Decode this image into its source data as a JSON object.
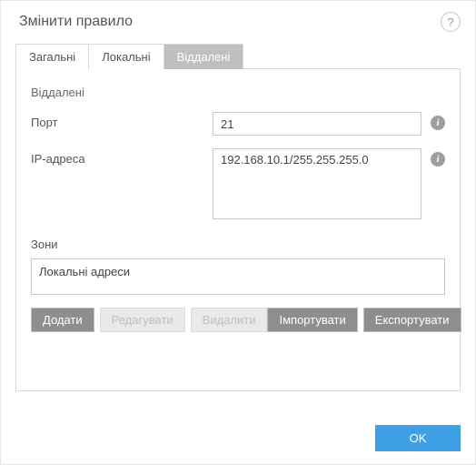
{
  "header": {
    "title": "Змінити правило",
    "help_tooltip": "?"
  },
  "tabs": {
    "general": "Загальні",
    "local": "Локальні",
    "remote": "Віддалені"
  },
  "panel": {
    "heading": "Віддалені",
    "port_label": "Порт",
    "port_value": "21",
    "ip_label": "IP-адреса",
    "ip_value": "192.168.10.1/255.255.255.0",
    "zones_label": "Зони",
    "zones_item": "Локальні адреси"
  },
  "buttons": {
    "add": "Додати",
    "edit": "Редагувати",
    "delete": "Видалити",
    "import": "Імпортувати",
    "export": "Експортувати",
    "ok": "OK"
  }
}
